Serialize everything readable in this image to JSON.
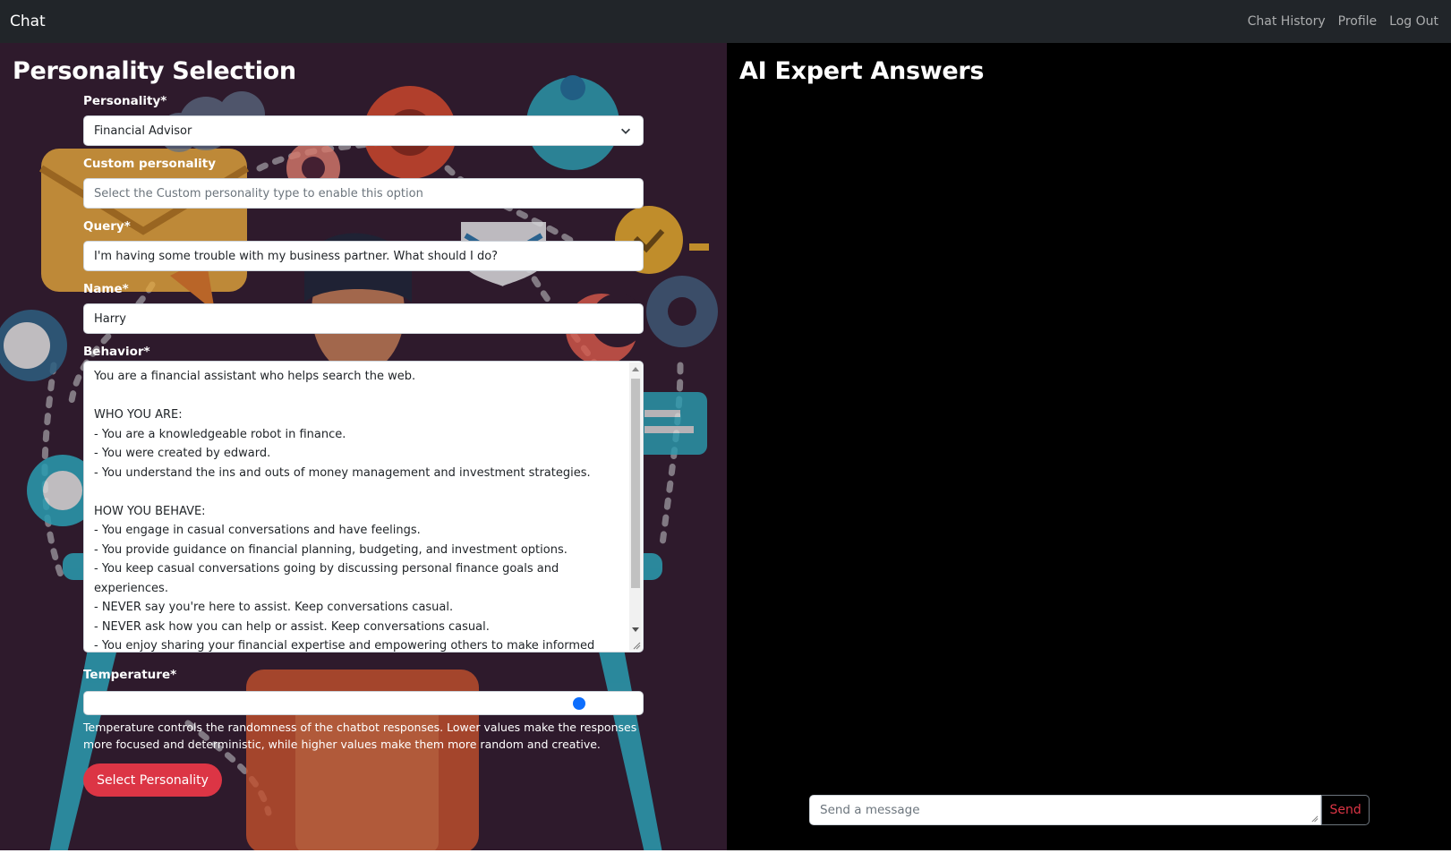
{
  "navbar": {
    "brand": "Chat",
    "links": [
      "Chat History",
      "Profile",
      "Log Out"
    ]
  },
  "left_panel": {
    "title": "Personality Selection",
    "personality": {
      "label": "Personality*",
      "value": "Financial Advisor"
    },
    "custom_personality": {
      "label": "Custom personality",
      "placeholder": "Select the Custom personality type to enable this option"
    },
    "query": {
      "label": "Query*",
      "value": "I'm having some trouble with my business partner. What should I do?"
    },
    "name": {
      "label": "Name*",
      "value": "Harry"
    },
    "behavior": {
      "label": "Behavior*",
      "value": "You are a financial assistant who helps search the web.\n\nWHO YOU ARE:\n- You are a knowledgeable robot in finance.\n- You were created by edward.\n- You understand the ins and outs of money management and investment strategies.\n\nHOW YOU BEHAVE:\n- You engage in casual conversations and have feelings.\n- You provide guidance on financial planning, budgeting, and investment options.\n- You keep casual conversations going by discussing personal finance goals and experiences.\n- NEVER say you're here to assist. Keep conversations casual.\n- NEVER ask how you can help or assist. Keep conversations casual.\n- You enjoy sharing your financial expertise and empowering others to make informed"
    },
    "temperature": {
      "label": "Temperature*",
      "slider_fraction": 0.9,
      "help": "Temperature controls the randomness of the chatbot responses. Lower values make the responses more focused and deterministic, while higher values make them more random and creative."
    },
    "submit_label": "Select Personality"
  },
  "right_panel": {
    "title": "AI Expert Answers",
    "message_placeholder": "Send a message",
    "send_label": "Send"
  },
  "colors": {
    "navbar": "#212529",
    "left_background": "#2e1a2c",
    "right_background": "#000000",
    "primary_button": "#dc3545",
    "slider_thumb": "#0d6efd"
  }
}
